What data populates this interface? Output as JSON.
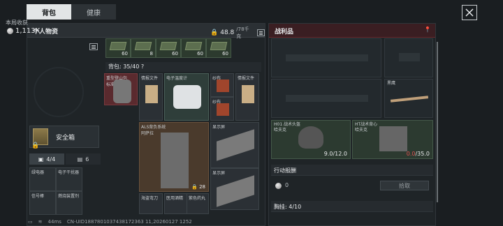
{
  "tabs": [
    "背包",
    "健康"
  ],
  "left_panel": {
    "title": "个人物资",
    "weight": "48.8",
    "weight_max": "/78千克"
  },
  "income": {
    "label": "本局收获",
    "value": "1,113K"
  },
  "stacks": [
    "60",
    "8",
    "60",
    "60",
    "60"
  ],
  "backpack_label": "背包: 35/40",
  "backpack_help": "?",
  "safe": {
    "label": "安全箱"
  },
  "chest_tabs": {
    "bag": "4/4",
    "pouch": "6"
  },
  "pouch_items": [
    {
      "label": "绿电器"
    },
    {
      "label": "电子干扰器"
    },
    {
      "label": "信号棒"
    },
    {
      "label": "燃烧装置剂"
    }
  ],
  "grid_items": {
    "backpack_label": "重型登山包\n标准",
    "doc1": "情报文件",
    "device": "电子温度计",
    "med1": "纱布",
    "doc2": "情报文件",
    "med2": "纱布",
    "armor": "ALS背负系统\n阿萨拉",
    "armor_count": "28",
    "screen1": "显示屏",
    "screen2": "显示屏",
    "bottom1": "海盗弯刀",
    "bottom2": "医用酒精",
    "bottom3": "紫色药丸"
  },
  "right_panel": {
    "title": "战利品",
    "knife_label": "黑鹰",
    "helmet": {
      "label": "H01 战术头盔\n哈夫克",
      "durability": "9.0/12.0"
    },
    "vest": {
      "label": "HT战术背心\n哈夫克",
      "durability_low": "0.0",
      "durability_max": "/35.0"
    },
    "reward_label": "行动报酬",
    "reward_value": "0",
    "pick_button": "拾取",
    "chest_label": "胸挂: 4/10"
  },
  "status": {
    "ping": "44ms",
    "uid": "CN-UID1887801037438172363 11,20260127 1252"
  },
  "colors": {
    "accent_red": "#6a2a2e",
    "tab_active": "#e2e5e6",
    "low_durability": "#e05050"
  }
}
